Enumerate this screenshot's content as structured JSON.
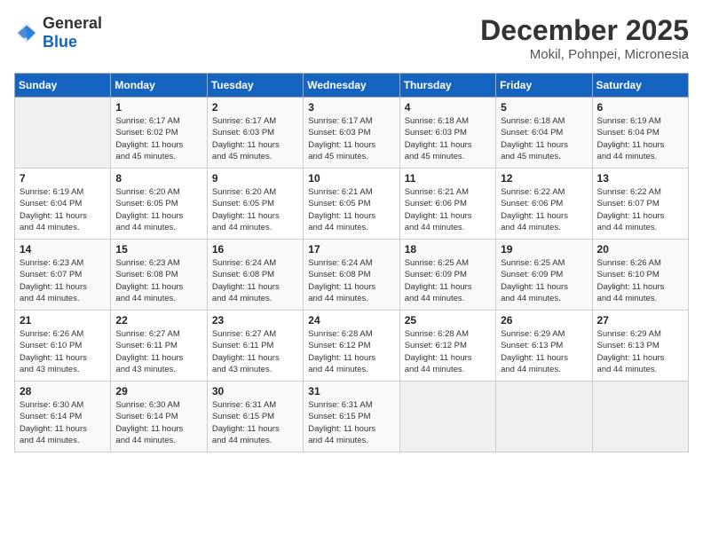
{
  "header": {
    "logo_general": "General",
    "logo_blue": "Blue",
    "month_title": "December 2025",
    "location": "Mokil, Pohnpei, Micronesia"
  },
  "days_of_week": [
    "Sunday",
    "Monday",
    "Tuesday",
    "Wednesday",
    "Thursday",
    "Friday",
    "Saturday"
  ],
  "weeks": [
    [
      {
        "day": "",
        "sunrise": "",
        "sunset": "",
        "daylight": ""
      },
      {
        "day": "1",
        "sunrise": "Sunrise: 6:17 AM",
        "sunset": "Sunset: 6:02 PM",
        "daylight": "Daylight: 11 hours and 45 minutes."
      },
      {
        "day": "2",
        "sunrise": "Sunrise: 6:17 AM",
        "sunset": "Sunset: 6:03 PM",
        "daylight": "Daylight: 11 hours and 45 minutes."
      },
      {
        "day": "3",
        "sunrise": "Sunrise: 6:17 AM",
        "sunset": "Sunset: 6:03 PM",
        "daylight": "Daylight: 11 hours and 45 minutes."
      },
      {
        "day": "4",
        "sunrise": "Sunrise: 6:18 AM",
        "sunset": "Sunset: 6:03 PM",
        "daylight": "Daylight: 11 hours and 45 minutes."
      },
      {
        "day": "5",
        "sunrise": "Sunrise: 6:18 AM",
        "sunset": "Sunset: 6:04 PM",
        "daylight": "Daylight: 11 hours and 45 minutes."
      },
      {
        "day": "6",
        "sunrise": "Sunrise: 6:19 AM",
        "sunset": "Sunset: 6:04 PM",
        "daylight": "Daylight: 11 hours and 44 minutes."
      }
    ],
    [
      {
        "day": "7",
        "sunrise": "Sunrise: 6:19 AM",
        "sunset": "Sunset: 6:04 PM",
        "daylight": "Daylight: 11 hours and 44 minutes."
      },
      {
        "day": "8",
        "sunrise": "Sunrise: 6:20 AM",
        "sunset": "Sunset: 6:05 PM",
        "daylight": "Daylight: 11 hours and 44 minutes."
      },
      {
        "day": "9",
        "sunrise": "Sunrise: 6:20 AM",
        "sunset": "Sunset: 6:05 PM",
        "daylight": "Daylight: 11 hours and 44 minutes."
      },
      {
        "day": "10",
        "sunrise": "Sunrise: 6:21 AM",
        "sunset": "Sunset: 6:05 PM",
        "daylight": "Daylight: 11 hours and 44 minutes."
      },
      {
        "day": "11",
        "sunrise": "Sunrise: 6:21 AM",
        "sunset": "Sunset: 6:06 PM",
        "daylight": "Daylight: 11 hours and 44 minutes."
      },
      {
        "day": "12",
        "sunrise": "Sunrise: 6:22 AM",
        "sunset": "Sunset: 6:06 PM",
        "daylight": "Daylight: 11 hours and 44 minutes."
      },
      {
        "day": "13",
        "sunrise": "Sunrise: 6:22 AM",
        "sunset": "Sunset: 6:07 PM",
        "daylight": "Daylight: 11 hours and 44 minutes."
      }
    ],
    [
      {
        "day": "14",
        "sunrise": "Sunrise: 6:23 AM",
        "sunset": "Sunset: 6:07 PM",
        "daylight": "Daylight: 11 hours and 44 minutes."
      },
      {
        "day": "15",
        "sunrise": "Sunrise: 6:23 AM",
        "sunset": "Sunset: 6:08 PM",
        "daylight": "Daylight: 11 hours and 44 minutes."
      },
      {
        "day": "16",
        "sunrise": "Sunrise: 6:24 AM",
        "sunset": "Sunset: 6:08 PM",
        "daylight": "Daylight: 11 hours and 44 minutes."
      },
      {
        "day": "17",
        "sunrise": "Sunrise: 6:24 AM",
        "sunset": "Sunset: 6:08 PM",
        "daylight": "Daylight: 11 hours and 44 minutes."
      },
      {
        "day": "18",
        "sunrise": "Sunrise: 6:25 AM",
        "sunset": "Sunset: 6:09 PM",
        "daylight": "Daylight: 11 hours and 44 minutes."
      },
      {
        "day": "19",
        "sunrise": "Sunrise: 6:25 AM",
        "sunset": "Sunset: 6:09 PM",
        "daylight": "Daylight: 11 hours and 44 minutes."
      },
      {
        "day": "20",
        "sunrise": "Sunrise: 6:26 AM",
        "sunset": "Sunset: 6:10 PM",
        "daylight": "Daylight: 11 hours and 44 minutes."
      }
    ],
    [
      {
        "day": "21",
        "sunrise": "Sunrise: 6:26 AM",
        "sunset": "Sunset: 6:10 PM",
        "daylight": "Daylight: 11 hours and 43 minutes."
      },
      {
        "day": "22",
        "sunrise": "Sunrise: 6:27 AM",
        "sunset": "Sunset: 6:11 PM",
        "daylight": "Daylight: 11 hours and 43 minutes."
      },
      {
        "day": "23",
        "sunrise": "Sunrise: 6:27 AM",
        "sunset": "Sunset: 6:11 PM",
        "daylight": "Daylight: 11 hours and 43 minutes."
      },
      {
        "day": "24",
        "sunrise": "Sunrise: 6:28 AM",
        "sunset": "Sunset: 6:12 PM",
        "daylight": "Daylight: 11 hours and 44 minutes."
      },
      {
        "day": "25",
        "sunrise": "Sunrise: 6:28 AM",
        "sunset": "Sunset: 6:12 PM",
        "daylight": "Daylight: 11 hours and 44 minutes."
      },
      {
        "day": "26",
        "sunrise": "Sunrise: 6:29 AM",
        "sunset": "Sunset: 6:13 PM",
        "daylight": "Daylight: 11 hours and 44 minutes."
      },
      {
        "day": "27",
        "sunrise": "Sunrise: 6:29 AM",
        "sunset": "Sunset: 6:13 PM",
        "daylight": "Daylight: 11 hours and 44 minutes."
      }
    ],
    [
      {
        "day": "28",
        "sunrise": "Sunrise: 6:30 AM",
        "sunset": "Sunset: 6:14 PM",
        "daylight": "Daylight: 11 hours and 44 minutes."
      },
      {
        "day": "29",
        "sunrise": "Sunrise: 6:30 AM",
        "sunset": "Sunset: 6:14 PM",
        "daylight": "Daylight: 11 hours and 44 minutes."
      },
      {
        "day": "30",
        "sunrise": "Sunrise: 6:31 AM",
        "sunset": "Sunset: 6:15 PM",
        "daylight": "Daylight: 11 hours and 44 minutes."
      },
      {
        "day": "31",
        "sunrise": "Sunrise: 6:31 AM",
        "sunset": "Sunset: 6:15 PM",
        "daylight": "Daylight: 11 hours and 44 minutes."
      },
      {
        "day": "",
        "sunrise": "",
        "sunset": "",
        "daylight": ""
      },
      {
        "day": "",
        "sunrise": "",
        "sunset": "",
        "daylight": ""
      },
      {
        "day": "",
        "sunrise": "",
        "sunset": "",
        "daylight": ""
      }
    ]
  ]
}
